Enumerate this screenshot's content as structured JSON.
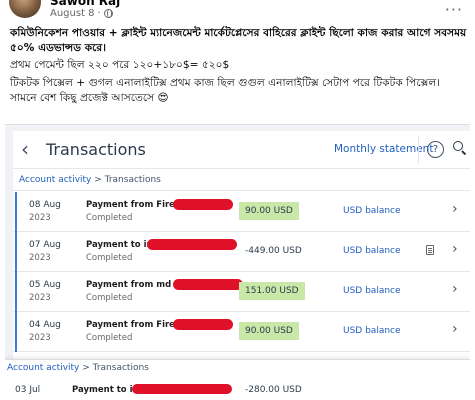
{
  "post": {
    "author": "Sawon Raj",
    "date": "August 8",
    "separator": "·",
    "text_line1": "কমিউনিকেশন পাওয়ার + ক্লাইন্ট ম্যানেজমেন্ট মার্কেটপ্লেসের বাহিরের ক্লাইন্ট ছিলো কাজ করার আগে সবসময় ৫০% এডভান্সড করে।",
    "text_line2": "প্রথম পেমেন্ট ছিল ২২০ পরে ১২০+১৮০$= ৫২০$",
    "text_line3": "টিকটক পিক্সেল + গুগল এনালাইটিক্স প্রথম কাজ ছিল গুগুল এনালাইটিক্স সেটাপ পরে টিকটক পিক্সেল। সামনে বেশ কিছু প্রজেক্ট আসতেসে 😍"
  },
  "transactions": {
    "title": "Transactions",
    "monthly_statement": "Monthly statement",
    "help_glyph": "?",
    "breadcrumb_link": "Account activity",
    "breadcrumb_sep": ">",
    "breadcrumb_current": "Transactions",
    "rows": [
      {
        "date": "08 Aug",
        "year": "2023",
        "desc": "Payment from Fire",
        "status": "Completed",
        "amount": "90.00 USD",
        "type": "credit",
        "balance": "USD balance",
        "has_doc": false
      },
      {
        "date": "07 Aug",
        "year": "2023",
        "desc": "Payment to im",
        "status": "Completed",
        "amount": "-449.00 USD",
        "type": "debit",
        "balance": "USD balance",
        "has_doc": true
      },
      {
        "date": "05 Aug",
        "year": "2023",
        "desc": "Payment from md",
        "status": "Completed",
        "amount": "151.00 USD",
        "type": "credit",
        "balance": "USD balance",
        "has_doc": false
      },
      {
        "date": "04 Aug",
        "year": "2023",
        "desc": "Payment from Fire",
        "status": "Completed",
        "amount": "90.00 USD",
        "type": "credit",
        "balance": "USD balance",
        "has_doc": false
      }
    ],
    "overlay": {
      "breadcrumb_link": "Account activity",
      "breadcrumb_sep": ">",
      "breadcrumb_current": "Transactions",
      "date": "03 Jul",
      "desc": "Payment to im",
      "amount": "-280.00 USD"
    },
    "colors": {
      "accent": "#1f5fbf",
      "credit_bg": "#c9e8a8",
      "redaction": "#e0102a"
    }
  }
}
